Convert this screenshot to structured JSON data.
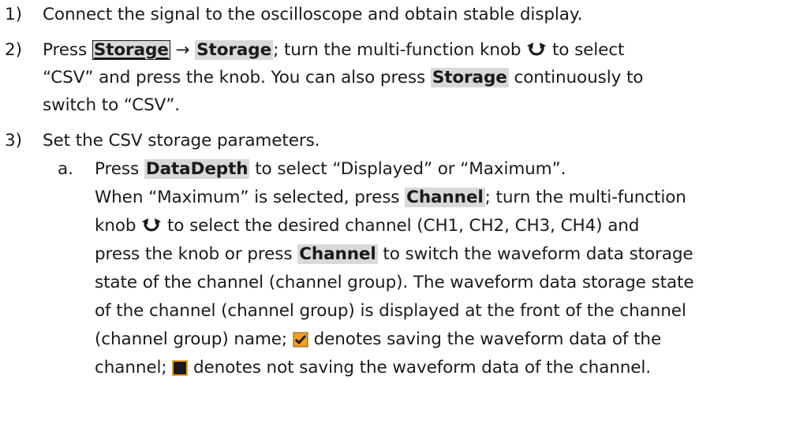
{
  "steps": [
    {
      "number": "1)",
      "lines": [
        "Connect the signal to the oscilloscope and obtain stable display."
      ]
    },
    {
      "number": "2)",
      "press": "Press",
      "key_storage_menu": "Storage",
      "arrow": "→",
      "key_storage_soft": "Storage",
      "l1_after": "; turn the multi-function knob",
      "l1_end": "to select",
      "l2_start": "“CSV” and press the knob. You can also press",
      "key_storage_again": "Storage",
      "l2_end": "continuously to",
      "l3": "switch to “CSV”."
    },
    {
      "number": "3)",
      "lines": [
        "Set the CSV storage parameters."
      ]
    }
  ],
  "substep": {
    "letter": "a.",
    "l1_press": "Press",
    "key_datadepth": "DataDepth",
    "l1_end": "to select “Displayed” or “Maximum”.",
    "l2_start": "When “Maximum” is selected, press",
    "key_channel": "Channel",
    "l2_end": "; turn the multi-function",
    "l3_start": "knob",
    "l3_end": "to select the desired channel (CH1, CH2, CH3, CH4) and",
    "l4_start": "press the knob or press",
    "key_channel_2": "Channel",
    "l4_end": "to switch the waveform data storage",
    "l5": "state of the channel (channel group). The waveform data storage state",
    "l6": "of the channel (channel group) is displayed at the front of the channel",
    "l7_start": "(channel group) name;",
    "l7_end": "denotes saving the waveform data of the",
    "l8_start": "channel;",
    "l8_end": "denotes not saving the waveform data of the channel."
  },
  "icons": {
    "knob": "multi-function-knob-icon",
    "checked": "checked-box-icon",
    "unchecked": "unchecked-box-icon"
  },
  "colors": {
    "key_highlight": "#d9d9d9",
    "checkbox_orange": "#f0a020",
    "checkbox_fill": "#1a1a1a"
  }
}
